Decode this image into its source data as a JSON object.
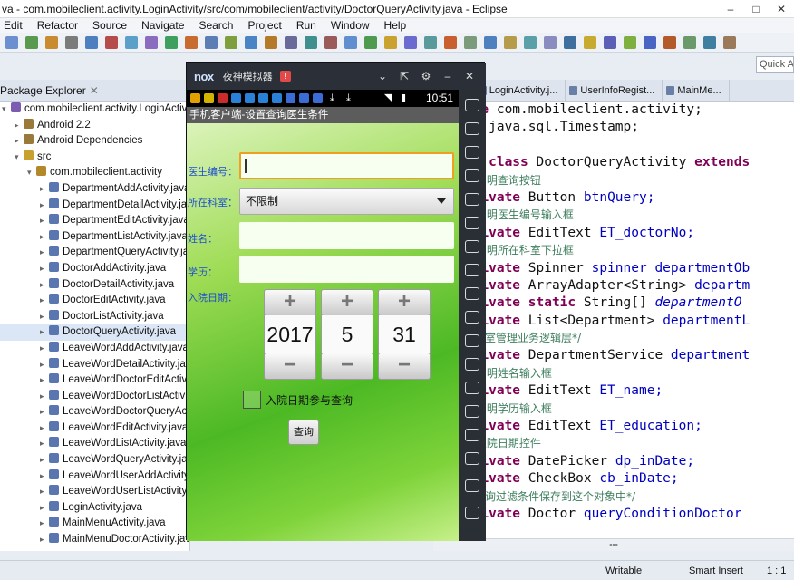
{
  "window": {
    "title": "va - com.mobileclient.activity.LoginActivity/src/com/mobileclient/activity/DoctorQueryActivity.java - Eclipse"
  },
  "menu": [
    "Edit",
    "Refactor",
    "Source",
    "Navigate",
    "Search",
    "Project",
    "Run",
    "Window",
    "Help"
  ],
  "quick_access": "Quick Ac",
  "package_explorer": {
    "tab_label": "Package Explorer",
    "items": [
      {
        "label": "com.mobileclient.activity.LoginActivity",
        "indent": 0,
        "arrow": "▾",
        "icon": "project-icon"
      },
      {
        "label": "Android 2.2",
        "indent": 1,
        "arrow": "▸",
        "icon": "library-icon"
      },
      {
        "label": "Android Dependencies",
        "indent": 1,
        "arrow": "▸",
        "icon": "library-icon"
      },
      {
        "label": "src",
        "indent": 1,
        "arrow": "▾",
        "icon": "src-folder-icon"
      },
      {
        "label": "com.mobileclient.activity",
        "indent": 2,
        "arrow": "▾",
        "icon": "package-icon"
      },
      {
        "label": "DepartmentAddActivity.java",
        "indent": 3,
        "arrow": "▸",
        "icon": "java-file-icon"
      },
      {
        "label": "DepartmentDetailActivity.java",
        "indent": 3,
        "arrow": "▸",
        "icon": "java-file-icon"
      },
      {
        "label": "DepartmentEditActivity.java",
        "indent": 3,
        "arrow": "▸",
        "icon": "java-file-icon"
      },
      {
        "label": "DepartmentListActivity.java",
        "indent": 3,
        "arrow": "▸",
        "icon": "java-file-icon"
      },
      {
        "label": "DepartmentQueryActivity.java",
        "indent": 3,
        "arrow": "▸",
        "icon": "java-file-icon"
      },
      {
        "label": "DoctorAddActivity.java",
        "indent": 3,
        "arrow": "▸",
        "icon": "java-file-icon"
      },
      {
        "label": "DoctorDetailActivity.java",
        "indent": 3,
        "arrow": "▸",
        "icon": "java-file-icon"
      },
      {
        "label": "DoctorEditActivity.java",
        "indent": 3,
        "arrow": "▸",
        "icon": "java-file-icon"
      },
      {
        "label": "DoctorListActivity.java",
        "indent": 3,
        "arrow": "▸",
        "icon": "java-file-icon"
      },
      {
        "label": "DoctorQueryActivity.java",
        "indent": 3,
        "arrow": "▸",
        "icon": "java-file-icon",
        "selected": true
      },
      {
        "label": "LeaveWordAddActivity.java",
        "indent": 3,
        "arrow": "▸",
        "icon": "java-file-icon"
      },
      {
        "label": "LeaveWordDetailActivity.java",
        "indent": 3,
        "arrow": "▸",
        "icon": "java-file-icon"
      },
      {
        "label": "LeaveWordDoctorEditActivity.java",
        "indent": 3,
        "arrow": "▸",
        "icon": "java-file-icon"
      },
      {
        "label": "LeaveWordDoctorListActivity.java",
        "indent": 3,
        "arrow": "▸",
        "icon": "java-file-icon"
      },
      {
        "label": "LeaveWordDoctorQueryActivity.java",
        "indent": 3,
        "arrow": "▸",
        "icon": "java-file-icon"
      },
      {
        "label": "LeaveWordEditActivity.java",
        "indent": 3,
        "arrow": "▸",
        "icon": "java-file-icon"
      },
      {
        "label": "LeaveWordListActivity.java",
        "indent": 3,
        "arrow": "▸",
        "icon": "java-file-icon"
      },
      {
        "label": "LeaveWordQueryActivity.java",
        "indent": 3,
        "arrow": "▸",
        "icon": "java-file-icon"
      },
      {
        "label": "LeaveWordUserAddActivity.java",
        "indent": 3,
        "arrow": "▸",
        "icon": "java-file-icon"
      },
      {
        "label": "LeaveWordUserListActivity.java",
        "indent": 3,
        "arrow": "▸",
        "icon": "java-file-icon"
      },
      {
        "label": "LoginActivity.java",
        "indent": 3,
        "arrow": "▸",
        "icon": "java-file-icon"
      },
      {
        "label": "MainMenuActivity.java",
        "indent": 3,
        "arrow": "▸",
        "icon": "java-file-icon"
      },
      {
        "label": "MainMenuDoctorActivity.java",
        "indent": 3,
        "arrow": "▸",
        "icon": "java-file-icon"
      }
    ]
  },
  "editor": {
    "tabs": [
      "...va",
      "LoginActivity.j...",
      "UserInfoRegist...",
      "MainMe..."
    ],
    "lines": [
      [
        [
          "kw",
          "package"
        ],
        [
          "",
          "com.mobileclient.activity;"
        ]
      ],
      [
        [
          "kw",
          "import"
        ],
        [
          "",
          "java.sql.Timestamp;"
        ]
      ],
      [
        [
          "",
          ""
        ]
      ],
      [
        [
          "kw",
          "public class"
        ],
        [
          "",
          "DoctorQueryActivity"
        ],
        [
          "kw",
          "extends"
        ]
      ],
      [
        [
          "",
          "    "
        ],
        [
          "cm",
          "// 声明查询按钮"
        ]
      ],
      [
        [
          "",
          "    "
        ],
        [
          "kw",
          "private"
        ],
        [
          "",
          "Button"
        ],
        [
          "fd",
          "btnQuery;"
        ]
      ],
      [
        [
          "",
          "    "
        ],
        [
          "cm",
          "// 声明医生编号输入框"
        ]
      ],
      [
        [
          "",
          "    "
        ],
        [
          "kw",
          "private"
        ],
        [
          "",
          "EditText"
        ],
        [
          "fd",
          "ET_doctorNo;"
        ]
      ],
      [
        [
          "",
          "    "
        ],
        [
          "cm",
          "// 声明所在科室下拉框"
        ]
      ],
      [
        [
          "",
          "    "
        ],
        [
          "kw",
          "private"
        ],
        [
          "",
          "Spinner"
        ],
        [
          "fd",
          "spinner_departmentOb"
        ]
      ],
      [
        [
          "",
          "    "
        ],
        [
          "kw",
          "private"
        ],
        [
          "",
          "ArrayAdapter<String>"
        ],
        [
          "fd",
          "departm"
        ]
      ],
      [
        [
          "",
          "    "
        ],
        [
          "kw",
          "private static"
        ],
        [
          "",
          "String[]"
        ],
        [
          "it",
          "departmentO"
        ]
      ],
      [
        [
          "",
          "    "
        ],
        [
          "kw",
          "private"
        ],
        [
          "",
          "List<Department>"
        ],
        [
          "fd",
          "departmentL"
        ]
      ],
      [
        [
          "",
          "    "
        ],
        [
          "cm",
          "/*科室管理业务逻辑层*/"
        ]
      ],
      [
        [
          "",
          "    "
        ],
        [
          "kw",
          "private"
        ],
        [
          "",
          "DepartmentService"
        ],
        [
          "fd",
          "department"
        ]
      ],
      [
        [
          "",
          "    "
        ],
        [
          "cm",
          "// 声明姓名输入框"
        ]
      ],
      [
        [
          "",
          "    "
        ],
        [
          "kw",
          "private"
        ],
        [
          "",
          "EditText"
        ],
        [
          "fd",
          "ET_name;"
        ]
      ],
      [
        [
          "",
          "    "
        ],
        [
          "cm",
          "// 声明学历输入框"
        ]
      ],
      [
        [
          "",
          "    "
        ],
        [
          "kw",
          "private"
        ],
        [
          "",
          "EditText"
        ],
        [
          "fd",
          "ET_education;"
        ]
      ],
      [
        [
          "",
          "    "
        ],
        [
          "cm",
          "// 入院日期控件"
        ]
      ],
      [
        [
          "",
          "    "
        ],
        [
          "kw",
          "private"
        ],
        [
          "",
          "DatePicker"
        ],
        [
          "fd",
          "dp_inDate;"
        ]
      ],
      [
        [
          "",
          "    "
        ],
        [
          "kw",
          "private"
        ],
        [
          "",
          "CheckBox"
        ],
        [
          "fd",
          "cb_inDate;"
        ]
      ],
      [
        [
          "",
          "    "
        ],
        [
          "cm",
          "/*查询过滤条件保存到这个对象中*/"
        ]
      ],
      [
        [
          "",
          "    "
        ],
        [
          "kw",
          "private"
        ],
        [
          "",
          "Doctor"
        ],
        [
          "fd",
          "queryConditionDoctor"
        ]
      ]
    ]
  },
  "status": {
    "writable": "Writable",
    "insert_mode": "Smart Insert",
    "position": "1 : 1"
  },
  "emulator": {
    "logo": "nox",
    "name": "夜神模拟器",
    "clock": "10:51",
    "app_title": "手机客户端-设置查询医生条件",
    "form": {
      "doctor_no_label": "医生编号：",
      "department_label": "所在科室：",
      "department_value": "不限制",
      "name_label": "姓名：",
      "education_label": "学历：",
      "indate_label": "入院日期：",
      "date": {
        "year": "2017",
        "month": "5",
        "day": "31"
      },
      "plus": "+",
      "minus": "−",
      "checkbox_label": "入院日期参与查询",
      "query_button": "查询"
    }
  }
}
